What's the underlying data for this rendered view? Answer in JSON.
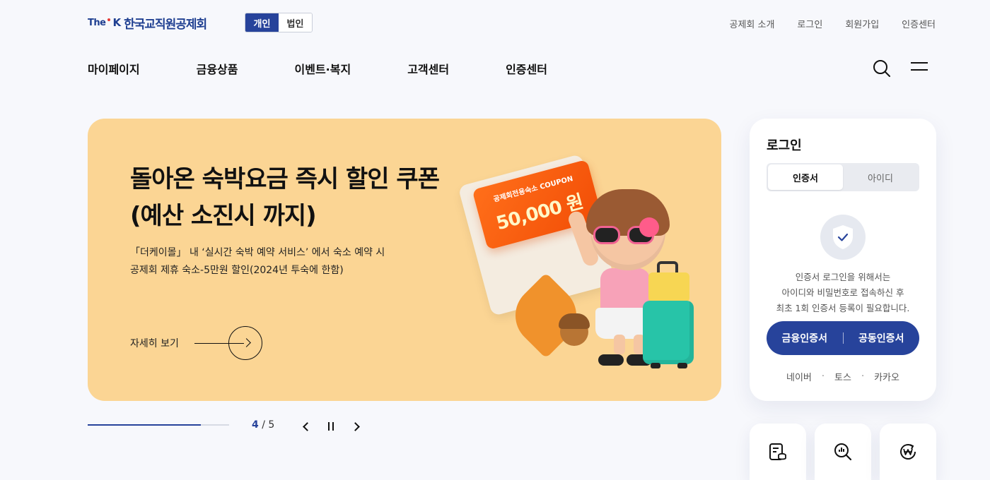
{
  "header": {
    "logo": {
      "prefix": "The",
      "k": "K",
      "name": "한국교직원공제회"
    },
    "member_toggle": {
      "personal": "개인",
      "corporate": "법인"
    },
    "util_links": [
      "공제회 소개",
      "로그인",
      "회원가입",
      "인증센터"
    ],
    "gnb": [
      "마이페이지",
      "금융상품",
      "이벤트·복지",
      "고객센터",
      "인증센터"
    ]
  },
  "banner": {
    "title_line1": "돌아온 숙박요금 즉시 할인 쿠폰",
    "title_line2": "(예산 소진시 까지)",
    "desc_line1": "「더케이몰」 내 ‘실시간 숙박 예약 서비스’ 에서 숙소 예약 시",
    "desc_line2": "공제회 제휴 숙소-5만원 할인(2024년 투숙에 한함)",
    "more_label": "자세히 보기",
    "coupon_small": "공제회전용숙소 COUPON",
    "coupon_amount": "50,000 원",
    "bg_color": "#fbd594"
  },
  "pager": {
    "current": "4",
    "total": "5",
    "progress": 0.8,
    "separator": "/"
  },
  "login": {
    "title": "로그인",
    "tabs": [
      "인증서",
      "아이디"
    ],
    "info_line1": "인증서 로그인을 위해서는",
    "info_line2": "아이디와 비밀번호로 접속하신 후",
    "info_line3": "최초 1회 인증서 등록이 필요합니다.",
    "btn_finance": "금융인증서",
    "btn_joint": "공동인증서",
    "social": [
      "네이버",
      "토스",
      "카카오"
    ],
    "social_sep": "·"
  },
  "colors": {
    "accent": "#27439b",
    "banner": "#fbd594"
  },
  "icons": {
    "search": "search-icon",
    "menu": "hamburger-menu-icon",
    "shield": "shield-check-icon",
    "quick": [
      "document-coins-icon",
      "search-chart-icon",
      "won-refresh-icon"
    ]
  }
}
